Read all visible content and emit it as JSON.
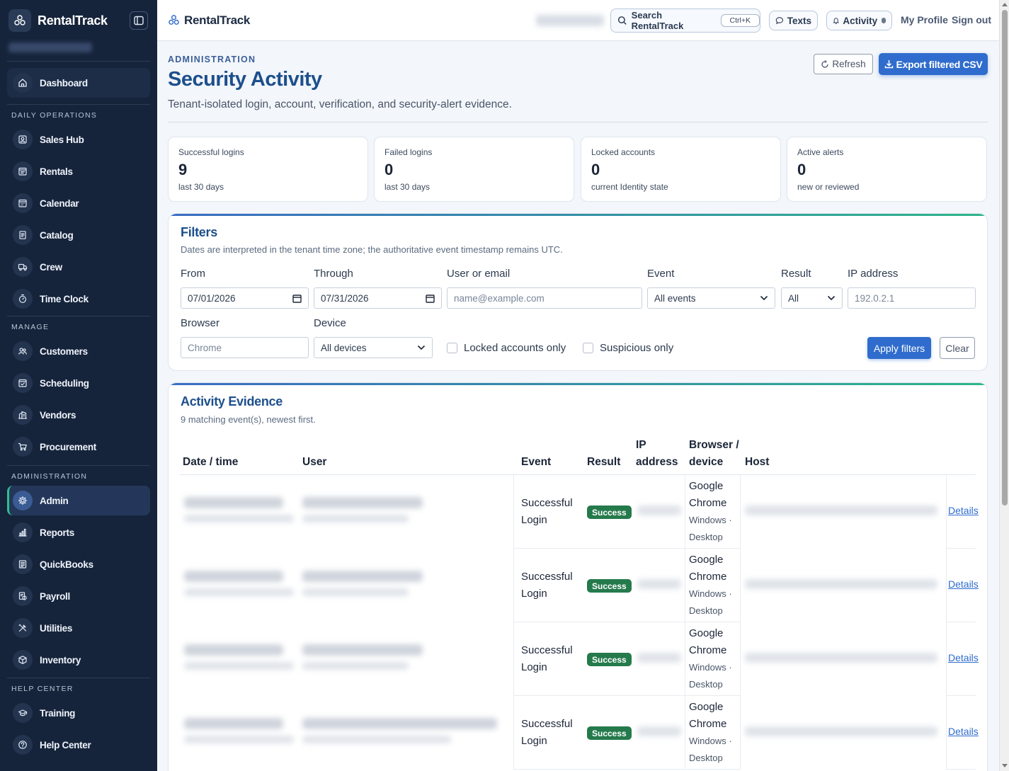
{
  "brand": "RentalTrack",
  "sidebar": {
    "dashboard": "Dashboard",
    "sections": {
      "daily": "DAILY OPERATIONS",
      "manage": "MANAGE",
      "admin": "ADMINISTRATION",
      "help": "HELP CENTER"
    },
    "daily_items": [
      {
        "label": "Sales Hub",
        "icon": "monitor-user-icon"
      },
      {
        "label": "Rentals",
        "icon": "calendar-list-icon"
      },
      {
        "label": "Calendar",
        "icon": "calendar-grid-icon"
      },
      {
        "label": "Catalog",
        "icon": "document-icon"
      },
      {
        "label": "Crew",
        "icon": "truck-icon"
      },
      {
        "label": "Time Clock",
        "icon": "stopwatch-icon"
      }
    ],
    "manage_items": [
      {
        "label": "Customers",
        "icon": "users-icon"
      },
      {
        "label": "Scheduling",
        "icon": "calendar-check-icon"
      },
      {
        "label": "Vendors",
        "icon": "building-icon"
      },
      {
        "label": "Procurement",
        "icon": "cart-icon"
      }
    ],
    "admin_items": [
      {
        "label": "Admin",
        "icon": "gear-icon"
      },
      {
        "label": "Reports",
        "icon": "bar-chart-icon"
      },
      {
        "label": "QuickBooks",
        "icon": "ledger-icon"
      },
      {
        "label": "Payroll",
        "icon": "payroll-icon"
      },
      {
        "label": "Utilities",
        "icon": "tools-icon"
      },
      {
        "label": "Inventory",
        "icon": "box-icon"
      }
    ],
    "help_items": [
      {
        "label": "Training",
        "icon": "graduation-cap-icon"
      },
      {
        "label": "Help Center",
        "icon": "question-icon"
      }
    ]
  },
  "topbar": {
    "brand": "RentalTrack",
    "search_label": "Search RentalTrack",
    "search_shortcut": "Ctrl+K",
    "texts": "Texts",
    "activity": "Activity",
    "profile": "My Profile",
    "signout": "Sign out"
  },
  "header": {
    "eyebrow": "ADMINISTRATION",
    "title": "Security Activity",
    "subtitle": "Tenant-isolated login, account, verification, and security-alert evidence.",
    "refresh": "Refresh",
    "export": "Export filtered CSV"
  },
  "stats": [
    {
      "label": "Successful logins",
      "value": "9",
      "sub": "last 30 days"
    },
    {
      "label": "Failed logins",
      "value": "0",
      "sub": "last 30 days"
    },
    {
      "label": "Locked accounts",
      "value": "0",
      "sub": "current Identity state"
    },
    {
      "label": "Active alerts",
      "value": "0",
      "sub": "new or reviewed"
    }
  ],
  "filters": {
    "title": "Filters",
    "subtitle": "Dates are interpreted in the tenant time zone; the authoritative event timestamp remains UTC.",
    "from_label": "From",
    "from_value": "07/01/2026",
    "through_label": "Through",
    "through_value": "07/31/2026",
    "user_label": "User or email",
    "user_placeholder": "name@example.com",
    "event_label": "Event",
    "event_value": "All events",
    "result_label": "Result",
    "result_value": "All",
    "ip_label": "IP address",
    "ip_placeholder": "192.0.2.1",
    "browser_label": "Browser",
    "browser_placeholder": "Chrome",
    "device_label": "Device",
    "device_value": "All devices",
    "locked_only": "Locked accounts only",
    "suspicious_only": "Suspicious only",
    "apply": "Apply filters",
    "clear": "Clear"
  },
  "evidence": {
    "title": "Activity Evidence",
    "subtitle": "9 matching event(s), newest first.",
    "columns": {
      "date": "Date / time",
      "user": "User",
      "event": "Event",
      "result": "Result",
      "ip_1": "IP",
      "ip_2": "address",
      "browser_1": "Browser /",
      "browser_2": "device",
      "host": "Host"
    },
    "rows": [
      {
        "event_1": "Successful",
        "event_2": "Login",
        "result": "Success",
        "browser_1": "Google",
        "browser_2": "Chrome",
        "device_1": "Windows ·",
        "device_2": "Desktop",
        "details": "Details"
      },
      {
        "event_1": "Successful",
        "event_2": "Login",
        "result": "Success",
        "browser_1": "Google",
        "browser_2": "Chrome",
        "device_1": "Windows ·",
        "device_2": "Desktop",
        "details": "Details"
      },
      {
        "event_1": "Successful",
        "event_2": "Login",
        "result": "Success",
        "browser_1": "Google",
        "browser_2": "Chrome",
        "device_1": "Windows ·",
        "device_2": "Desktop",
        "details": "Details"
      },
      {
        "event_1": "Successful",
        "event_2": "Login",
        "result": "Success",
        "browser_1": "Google",
        "browser_2": "Chrome",
        "device_1": "Windows ·",
        "device_2": "Desktop",
        "details": "Details"
      }
    ]
  },
  "colors": {
    "sidebar_bg": "#16243b",
    "accent": "#2f6ccd",
    "title": "#1d4f8c",
    "success": "#257a4c"
  }
}
